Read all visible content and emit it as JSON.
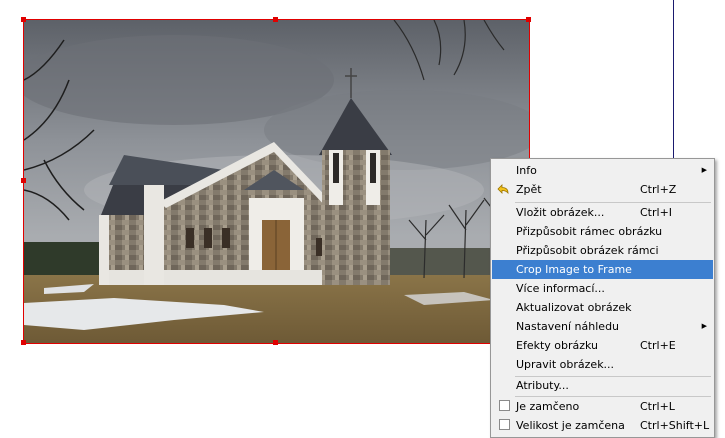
{
  "menu": {
    "items": [
      {
        "label": "Info",
        "shortcut": "",
        "submenu": true
      },
      {
        "label": "Zpět",
        "shortcut": "Ctrl+Z",
        "icon": "undo-arrow-icon"
      },
      {
        "label": "Vložit obrázek...",
        "shortcut": "Ctrl+I"
      },
      {
        "label": "Přizpůsobit rámec obrázku",
        "shortcut": ""
      },
      {
        "label": "Přizpůsobit obrázek rámci",
        "shortcut": ""
      },
      {
        "label": "Crop Image to Frame",
        "shortcut": "",
        "highlighted": true
      },
      {
        "label": "Více informací...",
        "shortcut": ""
      },
      {
        "label": "Aktualizovat obrázek",
        "shortcut": ""
      },
      {
        "label": "Nastavení náhledu",
        "shortcut": "",
        "submenu": true
      },
      {
        "label": "Efekty obrázku",
        "shortcut": "Ctrl+E"
      },
      {
        "label": "Upravit obrázek...",
        "shortcut": ""
      },
      {
        "label": "Atributy...",
        "shortcut": ""
      },
      {
        "label": "Je zamčeno",
        "shortcut": "Ctrl+L",
        "checkbox": true
      },
      {
        "label": "Velikost je zamčena",
        "shortcut": "Ctrl+Shift+L",
        "checkbox": true
      }
    ]
  },
  "colors": {
    "frame_border": "#e00000",
    "menu_highlight": "#3c7fd0",
    "menu_background": "#f0f0f0"
  }
}
